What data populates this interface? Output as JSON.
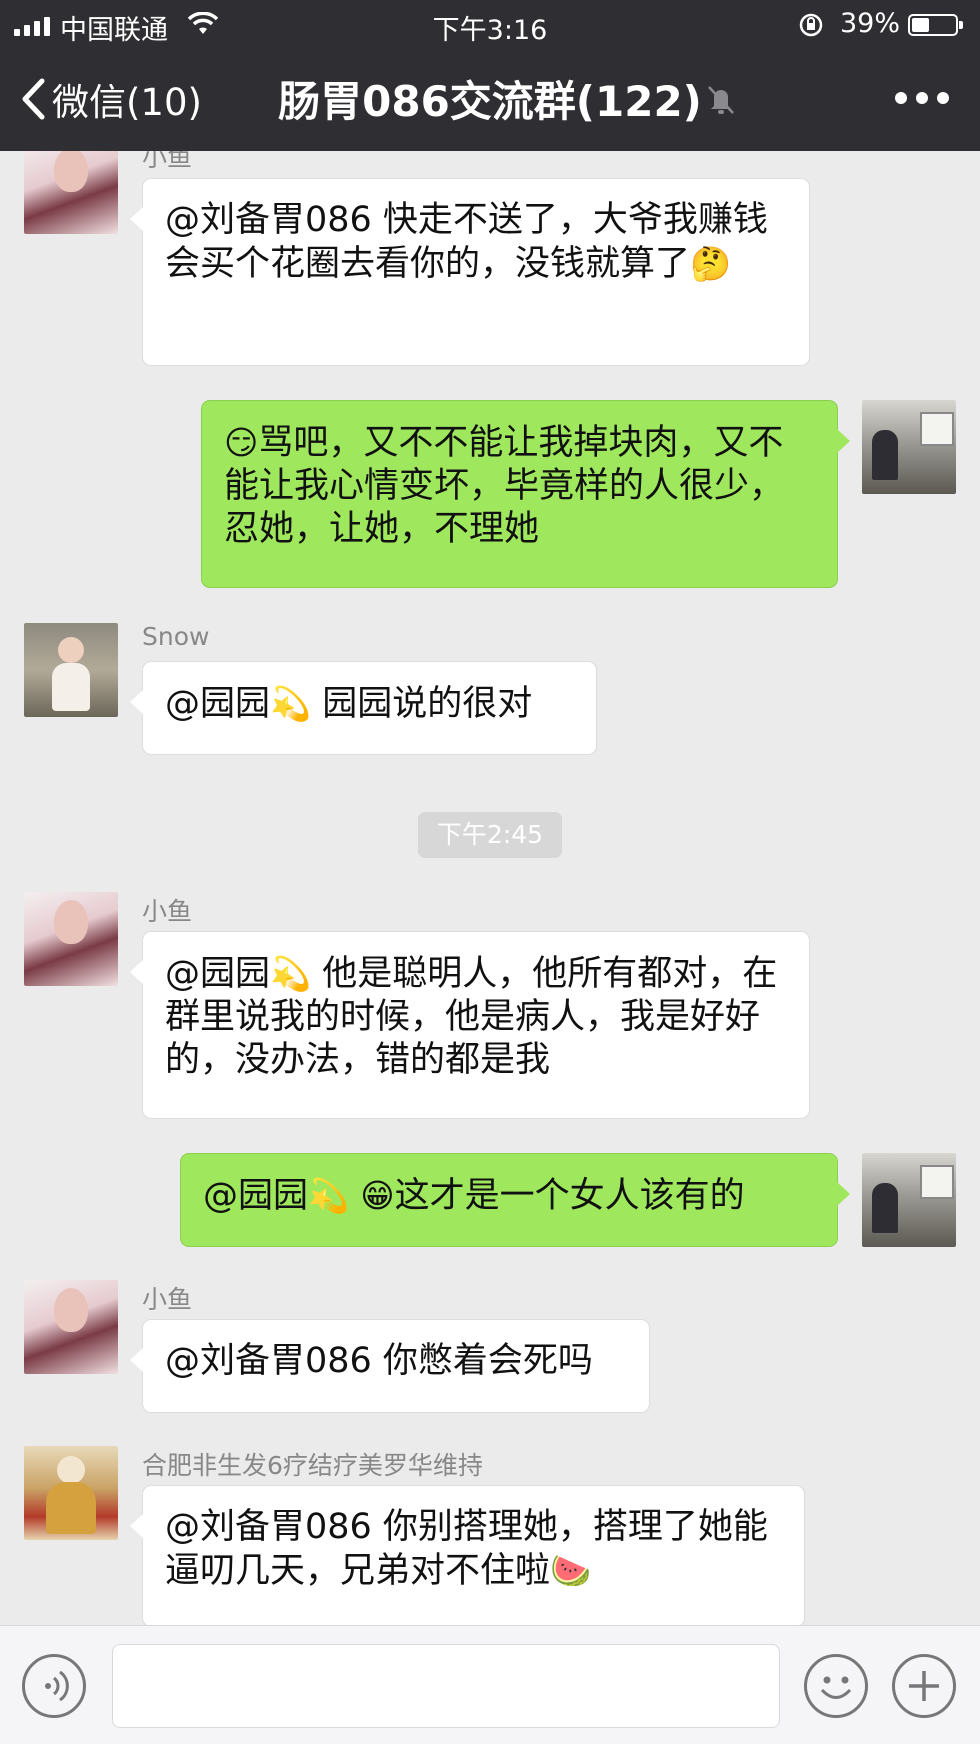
{
  "status_bar": {
    "carrier": "中国联通",
    "time": "下午3:16",
    "battery_percent": "39%",
    "battery_level": 0.39
  },
  "nav": {
    "back_label": "微信(10)",
    "title": "肠胃086交流群(122)"
  },
  "messages": [
    {
      "side": "in",
      "sender": "小鱼",
      "text": "@刘备胃086 快走不送了，大爷我赚钱会买个花圈去看你的，没钱就算了",
      "emoji": "🤔"
    },
    {
      "side": "out",
      "emoji": "😏",
      "text": "骂吧，又不不能让我掉块肉，又不能让我心情变坏，毕竟样的人很少，忍她，让她，不理她"
    },
    {
      "side": "in",
      "sender": "Snow",
      "mention": "@园园",
      "emoji": "💫",
      "text": " 园园说的很对"
    },
    {
      "side": "in",
      "sender": "小鱼",
      "mention": "@园园",
      "emoji": "💫",
      "text": " 他是聪明人，他所有都对，在群里说我的时候，他是病人，我是好好的，没办法，错的都是我"
    },
    {
      "side": "out",
      "mention": "@园园",
      "emoji": "💫",
      "emoji2": "😁",
      "text": "这才是一个女人该有的"
    },
    {
      "side": "in",
      "sender": "小鱼",
      "text": "@刘备胃086 你憋着会死吗"
    },
    {
      "side": "in",
      "sender": "合肥非生发6疗结疗美罗华维持",
      "text": "@刘备胃086 你别搭理她，搭理了她能逼叨几天，兄弟对不住啦",
      "emoji": "🍉"
    }
  ],
  "timestamp": "下午2:45",
  "colors": {
    "topbar": "#2e2e33",
    "background": "#ebebeb",
    "outgoing_bubble": "#9fe85d",
    "incoming_bubble": "#ffffff"
  }
}
